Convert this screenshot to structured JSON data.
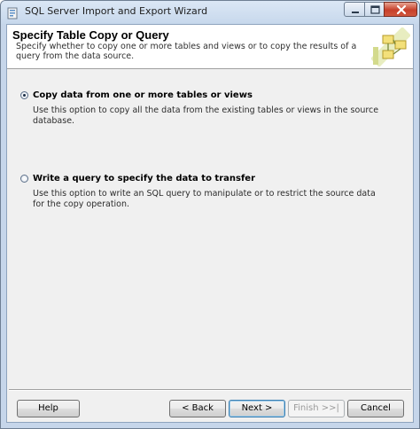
{
  "window": {
    "title": "SQL Server Import and Export Wizard"
  },
  "header": {
    "title": "Specify Table Copy or Query",
    "description": "Specify whether to copy one or more tables and views or to copy the results of a query from the data source."
  },
  "options": [
    {
      "label": "Copy data from one or more tables or views",
      "description": "Use this option to copy all the data from the existing tables or views in the source database.",
      "selected": true
    },
    {
      "label": "Write a query to specify the data to transfer",
      "description": "Use this option to write an SQL query to manipulate or to restrict the source data for the copy operation.",
      "selected": false
    }
  ],
  "buttons": {
    "help": "Help",
    "back": "< Back",
    "next": "Next >",
    "finish": "Finish >>|",
    "cancel": "Cancel"
  },
  "icons": {
    "app": "wizard-app-icon",
    "header": "data-transfer-graphic",
    "minimize": "minimize-icon",
    "maximize": "maximize-icon",
    "close": "close-icon"
  },
  "colors": {
    "close_button": "#c7402b",
    "default_button_border": "#3c7fb1"
  }
}
